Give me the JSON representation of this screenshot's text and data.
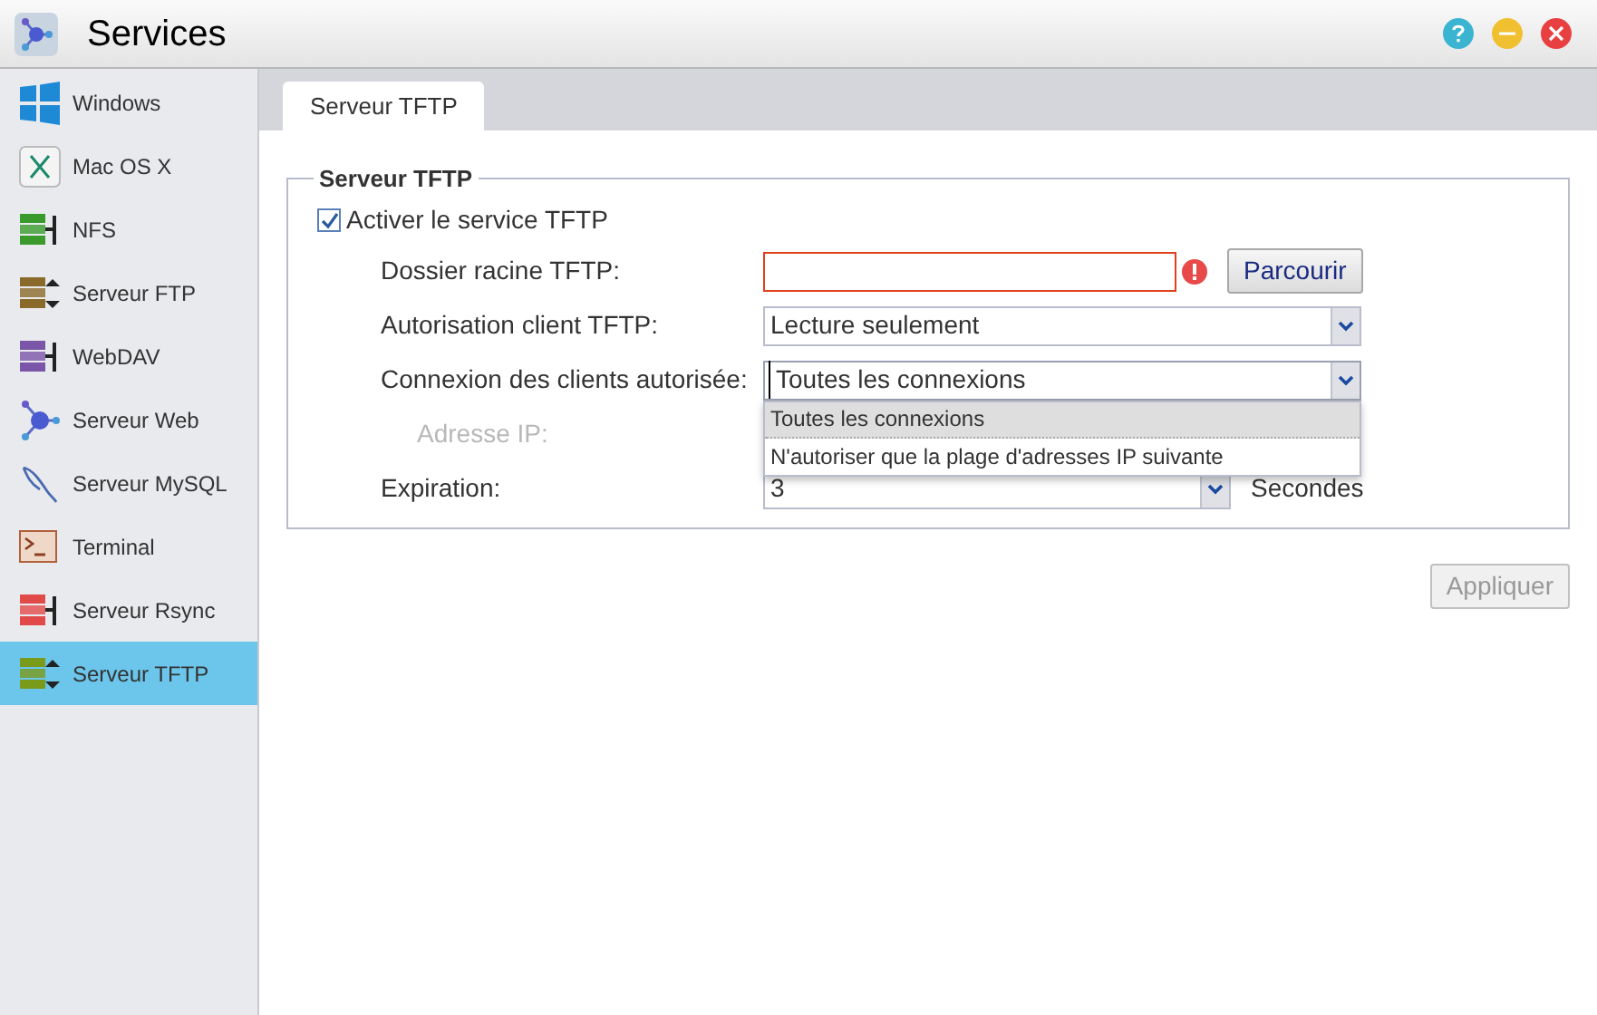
{
  "window": {
    "title": "Services"
  },
  "sidebar": {
    "items": [
      {
        "label": "Windows",
        "kind": "windows",
        "selected": false
      },
      {
        "label": "Mac OS X",
        "kind": "mac",
        "selected": false
      },
      {
        "label": "NFS",
        "kind": "nfs",
        "selected": false
      },
      {
        "label": "Serveur FTP",
        "kind": "ftp",
        "selected": false
      },
      {
        "label": "WebDAV",
        "kind": "webdav",
        "selected": false
      },
      {
        "label": "Serveur Web",
        "kind": "web",
        "selected": false
      },
      {
        "label": "Serveur MySQL",
        "kind": "mysql",
        "selected": false
      },
      {
        "label": "Terminal",
        "kind": "terminal",
        "selected": false
      },
      {
        "label": "Serveur Rsync",
        "kind": "rsync",
        "selected": false
      },
      {
        "label": "Serveur TFTP",
        "kind": "tftp",
        "selected": true
      }
    ]
  },
  "tabs": [
    {
      "label": "Serveur TFTP",
      "selected": true
    }
  ],
  "group": {
    "legend": "Serveur TFTP",
    "enable": {
      "label": "Activer le service TFTP",
      "checked": true
    },
    "fields": [
      {
        "kind": "path",
        "label": "Dossier racine TFTP:",
        "error": true,
        "button": "Parcourir"
      },
      {
        "kind": "select",
        "label": "Autorisation client TFTP:",
        "value": "Lecture seulement"
      },
      {
        "kind": "open-select",
        "label": "Connexion des clients autorisée:",
        "value": "Toutes les connexions",
        "options": [
          {
            "label": "Toutes les connexions",
            "selected": true
          },
          {
            "label": "N'autoriser que la plage d'adresses IP suivante",
            "selected": false
          }
        ]
      },
      {
        "kind": "hidden",
        "label": "Adresse IP:",
        "disabled": true
      },
      {
        "kind": "unit-select",
        "label": "Expiration:",
        "value": "3",
        "unit": "Secondes"
      }
    ]
  },
  "apply_button": {
    "label": "Appliquer",
    "disabled": true
  }
}
